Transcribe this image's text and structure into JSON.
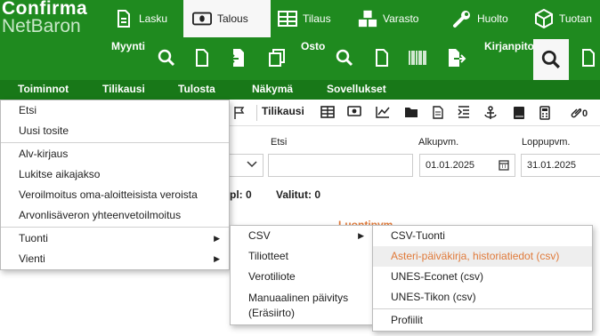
{
  "logo": {
    "line1": "Confirma",
    "line2": "NetBaron"
  },
  "modules": [
    {
      "label": "Lasku",
      "icon": "document-icon"
    },
    {
      "label": "Talous",
      "icon": "money-icon",
      "active": true
    },
    {
      "label": "Tilaus",
      "icon": "table-icon"
    },
    {
      "label": "Varasto",
      "icon": "boxes-icon"
    },
    {
      "label": "Huolto",
      "icon": "wrench-icon"
    },
    {
      "label": "Tuotan",
      "icon": "cube-icon"
    }
  ],
  "groups": {
    "myynti": "Myynti",
    "osto": "Osto",
    "kirjanpito": "Kirjanpito"
  },
  "menubar": [
    "Toiminnot",
    "Tilikausi",
    "Tulosta",
    "Näkymä",
    "Sovellukset"
  ],
  "subtoolbar": {
    "title": "Tilikausi"
  },
  "filters": {
    "etsi_label": "Etsi",
    "alkupvm_label": "Alkupvm.",
    "alkupvm_value": "01.01.2025",
    "loppupvm_label": "Loppupvm.",
    "loppupvm_value": "31.01.2025"
  },
  "stats": {
    "kpl": "pl: 0",
    "valitut": "Valitut: 0"
  },
  "column_header": "Luontipvm",
  "menu_main": {
    "items": [
      "Etsi",
      "Uusi tosite",
      "Alv-kirjaus",
      "Lukitse aikajakso",
      "Veroilmoitus oma-aloitteisista veroista",
      "Arvonlisäveron yhteenvetoilmoitus",
      "Tuonti",
      "Vienti"
    ]
  },
  "menu_tuonti": {
    "items": [
      "CSV",
      "Tiliotteet",
      "Verotiliote",
      "Manuaalinen päivitys",
      "(Eräsiirto)"
    ]
  },
  "menu_csv": {
    "items": [
      "CSV-Tuonti",
      "Asteri-päiväkirja, historiatiedot (csv)",
      "UNES-Econet (csv)",
      "UNES-Tikon (csv)",
      "Profiilit"
    ]
  },
  "colors": {
    "green": "#1f8a1f",
    "menubar": "#187818",
    "highlight_text": "#e07a3a"
  }
}
